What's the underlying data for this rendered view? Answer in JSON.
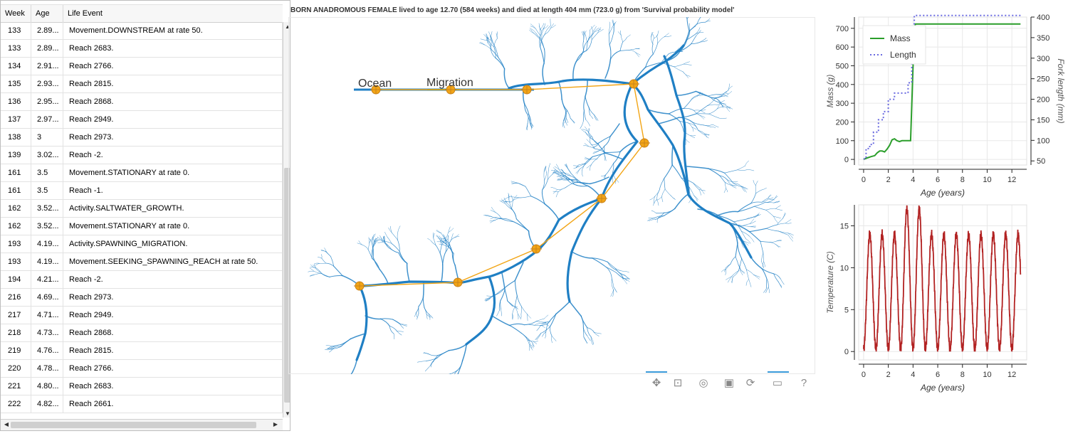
{
  "table": {
    "headers": {
      "week": "Week",
      "age": "Age",
      "event": "Life Event"
    },
    "rows": [
      {
        "week": "133",
        "age": "2.89...",
        "event": "Movement.DOWNSTREAM at rate 50."
      },
      {
        "week": "133",
        "age": "2.89...",
        "event": "Reach 2683."
      },
      {
        "week": "134",
        "age": "2.91...",
        "event": "Reach 2766."
      },
      {
        "week": "135",
        "age": "2.93...",
        "event": "Reach 2815."
      },
      {
        "week": "136",
        "age": "2.95...",
        "event": "Reach 2868."
      },
      {
        "week": "137",
        "age": "2.97...",
        "event": "Reach 2949."
      },
      {
        "week": "138",
        "age": "3",
        "event": "Reach 2973."
      },
      {
        "week": "139",
        "age": "3.02...",
        "event": "Reach -2."
      },
      {
        "week": "161",
        "age": "3.5",
        "event": "Movement.STATIONARY at rate 0."
      },
      {
        "week": "161",
        "age": "3.5",
        "event": "Reach -1."
      },
      {
        "week": "162",
        "age": "3.52...",
        "event": "Activity.SALTWATER_GROWTH."
      },
      {
        "week": "162",
        "age": "3.52...",
        "event": "Movement.STATIONARY at rate 0."
      },
      {
        "week": "193",
        "age": "4.19...",
        "event": "Activity.SPAWNING_MIGRATION."
      },
      {
        "week": "193",
        "age": "4.19...",
        "event": "Movement.SEEKING_SPAWNING_REACH at rate 50."
      },
      {
        "week": "194",
        "age": "4.21...",
        "event": "Reach -2."
      },
      {
        "week": "216",
        "age": "4.69...",
        "event": "Reach 2973."
      },
      {
        "week": "217",
        "age": "4.71...",
        "event": "Reach 2949."
      },
      {
        "week": "218",
        "age": "4.73...",
        "event": "Reach 2868."
      },
      {
        "week": "219",
        "age": "4.76...",
        "event": "Reach 2815."
      },
      {
        "week": "220",
        "age": "4.78...",
        "event": "Reach 2766."
      },
      {
        "week": "221",
        "age": "4.80...",
        "event": "Reach 2683."
      },
      {
        "week": "222",
        "age": "4.82...",
        "event": "Reach 2661."
      }
    ]
  },
  "map": {
    "title": "BORN ANADROMOUS FEMALE lived to age 12.70 (584 weeks) and died at length 404 mm (723.0 g) from 'Survival probability model'",
    "ocean_label": "Ocean",
    "migration_label": "Migration",
    "river_color": "#1f7fc4",
    "path_color": "#f2a516"
  },
  "toolbar": [
    "pan-icon",
    "box-zoom-icon",
    "wheel-zoom-icon",
    "save-icon",
    "reset-icon",
    "hover-icon",
    "help-icon"
  ],
  "chart_data": [
    {
      "type": "line",
      "xlabel": "Age (years)",
      "ylabel": "Mass (g)",
      "y2label": "Fork length (mm)",
      "xlim": [
        -0.4,
        13.2
      ],
      "ylim": [
        -30,
        760
      ],
      "y2lim": [
        40,
        400
      ],
      "xticks": [
        0,
        2,
        4,
        6,
        8,
        10,
        12
      ],
      "yticks": [
        0,
        100,
        200,
        300,
        400,
        500,
        600,
        700
      ],
      "y2ticks": [
        50,
        100,
        150,
        200,
        250,
        300,
        350,
        400
      ],
      "legend": "top-left",
      "series": [
        {
          "name": "Mass",
          "color": "#2a9e2a",
          "axis": "left",
          "x": [
            0,
            0.3,
            0.6,
            0.9,
            1.1,
            1.3,
            1.5,
            1.7,
            1.9,
            2.1,
            2.3,
            2.5,
            2.7,
            2.9,
            3.1,
            3.5,
            3.8,
            4.0,
            4.1,
            4.2,
            5.0,
            8.0,
            12.7
          ],
          "y": [
            0,
            8,
            15,
            20,
            35,
            45,
            45,
            40,
            55,
            75,
            105,
            110,
            100,
            95,
            100,
            100,
            100,
            500,
            700,
            723,
            723,
            723,
            723
          ]
        },
        {
          "name": "Length",
          "color": "#6b6be0",
          "axis": "right",
          "dash": true,
          "x": [
            0,
            0.2,
            0.2,
            0.5,
            0.5,
            0.8,
            0.8,
            1.2,
            1.2,
            1.6,
            1.6,
            2.0,
            2.0,
            2.5,
            2.5,
            3.6,
            3.6,
            3.9,
            3.9,
            4.1,
            4.1,
            12.7
          ],
          "y": [
            55,
            55,
            80,
            80,
            90,
            90,
            120,
            120,
            150,
            150,
            170,
            170,
            200,
            200,
            215,
            215,
            240,
            240,
            300,
            300,
            404,
            404
          ]
        }
      ]
    },
    {
      "type": "line",
      "xlabel": "Age (years)",
      "ylabel": "Temperature (C)",
      "xlim": [
        -0.4,
        13.2
      ],
      "ylim": [
        -1,
        17.5
      ],
      "xticks": [
        0,
        2,
        4,
        6,
        8,
        10,
        12
      ],
      "yticks": [
        0,
        5,
        10,
        15
      ],
      "series": [
        {
          "name": "",
          "color": "#b22222",
          "period": 1.0,
          "min": 0.3,
          "max": 14,
          "warm_years": [
            3,
            4
          ],
          "warm_max": 17,
          "start": 0,
          "end": 12.7
        }
      ]
    }
  ]
}
